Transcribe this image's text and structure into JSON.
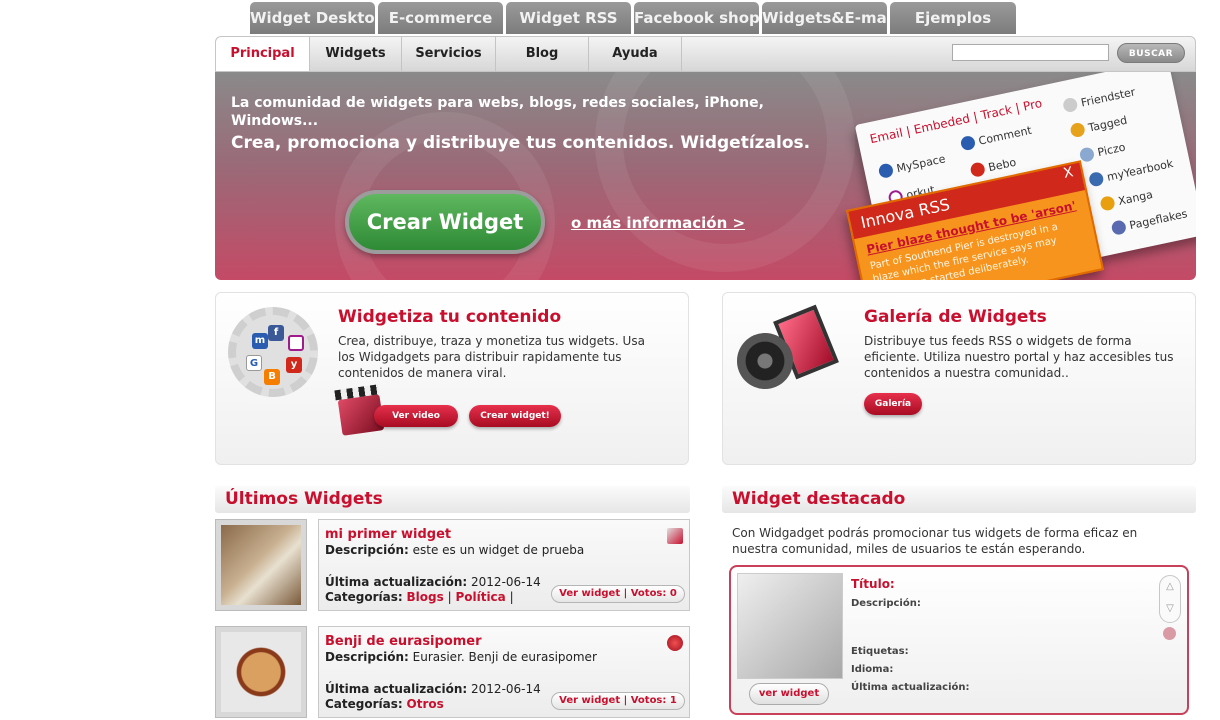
{
  "top_tabs": [
    "Widget Desktop",
    "E-commerce",
    "Widget RSS",
    "Facebook shop",
    "Widgets&E-mail",
    "Ejemplos"
  ],
  "nav": {
    "items": [
      "Principal",
      "Widgets",
      "Servicios",
      "Blog",
      "Ayuda"
    ],
    "search_placeholder": "",
    "search_button": "BUSCAR"
  },
  "hero": {
    "line1": "La comunidad de widgets para webs, blogs, redes sociales, iPhone, Windows...",
    "line2": "Crea, promociona y distribuye tus contenidos. Widgetízalos.",
    "cta": "Crear Widget",
    "more_info": "o más información >",
    "mock": {
      "links": "Email | Embeded | Track | Pro",
      "services": [
        "MySpace",
        "Comment",
        "orkut",
        "Bebo",
        "Friendster",
        "Tagged",
        "Piczo",
        "myYearbook",
        "Xanga",
        "Pageflakes"
      ],
      "rss_title": "Innova RSS",
      "rss_close": "X",
      "rss_headline": "Pier blaze thought to be 'arson'",
      "rss_body": "Part of Southend Pier is destroyed in a blaze which the fire service says may have been started deliberately."
    }
  },
  "feature_left": {
    "title": "Widgetiza tu contenido",
    "desc": "Crea, distribuye, traza y monetiza tus widgets. Usa los Widgadgets para distribuir rapidamente tus contenidos de manera viral.",
    "btn_video": "Ver video",
    "btn_create": "Crear widget!"
  },
  "feature_right": {
    "title": "Galería de Widgets",
    "desc": "Distribuye tus feeds RSS o widgets de forma eficiente. Utiliza nuestro portal y haz accesibles tus contenidos a nuestra comunidad..",
    "btn_gallery": "Galería"
  },
  "latest": {
    "heading": "Últimos Widgets",
    "desc_label": "Descripción:",
    "updated_label": "Última actualización:",
    "cats_label": "Categorías:",
    "items": [
      {
        "title": "mi primer widget",
        "desc": "este es un widget de prueba",
        "updated": "2012-06-14",
        "cat1": "Blogs",
        "cat2": "Política",
        "button": "Ver widget | Votos: 0"
      },
      {
        "title": "Benji de eurasipomer",
        "desc": "Eurasier. Benji de eurasipomer",
        "updated": "2012-06-14",
        "cat1": "Otros",
        "button": "Ver widget | Votos: 1"
      }
    ]
  },
  "featured": {
    "heading": "Widget destacado",
    "intro": "Con Widgadget podrás promocionar tus widgets de forma eficaz en nuestra comunidad, miles de usuarios te están esperando.",
    "title_label": "Título:",
    "desc_label": "Descripción:",
    "tags_label": "Etiquetas:",
    "lang_label": "Idioma:",
    "updated_label": "Última actualización:",
    "button": "ver widget",
    "scroll_up": "△",
    "scroll_down": "▽"
  },
  "colors": {
    "accent": "#c8102e",
    "green_cta": "#2f8a36",
    "tab_grey": "#8a8a8a"
  }
}
